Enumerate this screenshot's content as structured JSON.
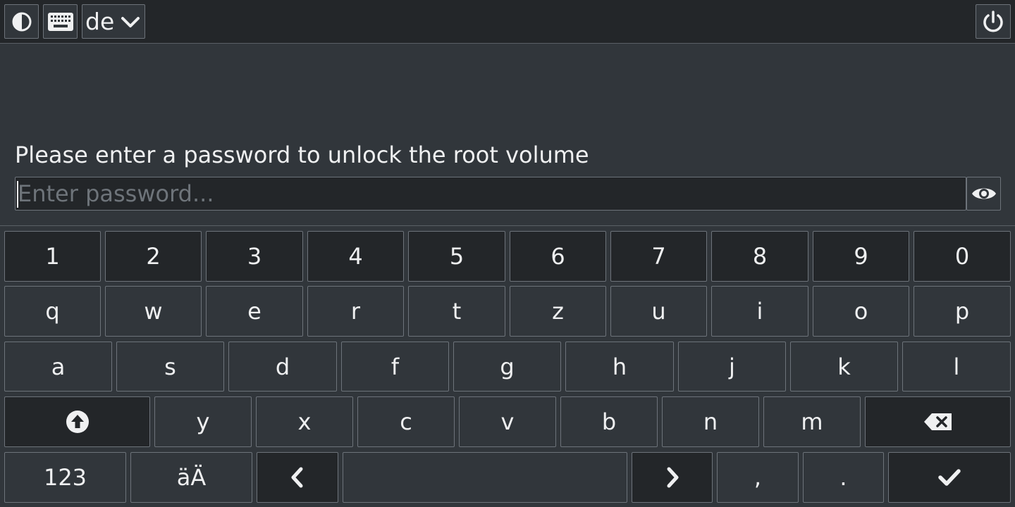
{
  "topbar": {
    "contrast_icon": "contrast-icon",
    "keyboard_icon": "keyboard-icon",
    "layout_label": "de",
    "layout_icon": "chevron-down-icon",
    "power_icon": "power-icon"
  },
  "unlock": {
    "prompt": "Please enter a password to unlock the root volume",
    "password_value": "",
    "password_placeholder": "Enter password...",
    "reveal_icon": "eye-icon"
  },
  "keyboard": {
    "row_numbers": [
      "1",
      "2",
      "3",
      "4",
      "5",
      "6",
      "7",
      "8",
      "9",
      "0"
    ],
    "row_top": [
      "q",
      "w",
      "e",
      "r",
      "t",
      "z",
      "u",
      "i",
      "o",
      "p"
    ],
    "row_home": [
      "a",
      "s",
      "d",
      "f",
      "g",
      "h",
      "j",
      "k",
      "l"
    ],
    "row_bottom": [
      "y",
      "x",
      "c",
      "v",
      "b",
      "n",
      "m"
    ],
    "shift_icon": "shift-arrow-up-icon",
    "backspace_icon": "backspace-icon",
    "symbols_label": "123",
    "umlaut_label": "äÄ",
    "left_icon": "chevron-left-icon",
    "space_label": "",
    "right_icon": "chevron-right-icon",
    "comma_label": ",",
    "period_label": ".",
    "enter_icon": "checkmark-icon"
  },
  "colors": {
    "background": "#31363b",
    "bar_background": "#232629",
    "border": "#6d737a",
    "text": "#eff0f1",
    "placeholder": "#6e747a"
  }
}
